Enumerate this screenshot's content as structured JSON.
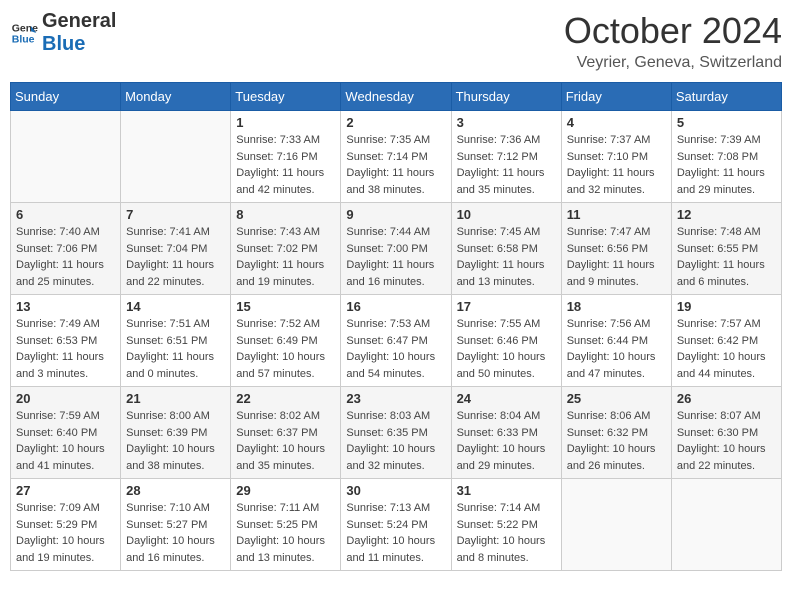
{
  "header": {
    "logo_text1": "General",
    "logo_text2": "Blue",
    "month": "October 2024",
    "location": "Veyrier, Geneva, Switzerland"
  },
  "weekdays": [
    "Sunday",
    "Monday",
    "Tuesday",
    "Wednesday",
    "Thursday",
    "Friday",
    "Saturday"
  ],
  "weeks": [
    [
      {
        "day": "",
        "sunrise": "",
        "sunset": "",
        "daylight": ""
      },
      {
        "day": "",
        "sunrise": "",
        "sunset": "",
        "daylight": ""
      },
      {
        "day": "1",
        "sunrise": "Sunrise: 7:33 AM",
        "sunset": "Sunset: 7:16 PM",
        "daylight": "Daylight: 11 hours and 42 minutes."
      },
      {
        "day": "2",
        "sunrise": "Sunrise: 7:35 AM",
        "sunset": "Sunset: 7:14 PM",
        "daylight": "Daylight: 11 hours and 38 minutes."
      },
      {
        "day": "3",
        "sunrise": "Sunrise: 7:36 AM",
        "sunset": "Sunset: 7:12 PM",
        "daylight": "Daylight: 11 hours and 35 minutes."
      },
      {
        "day": "4",
        "sunrise": "Sunrise: 7:37 AM",
        "sunset": "Sunset: 7:10 PM",
        "daylight": "Daylight: 11 hours and 32 minutes."
      },
      {
        "day": "5",
        "sunrise": "Sunrise: 7:39 AM",
        "sunset": "Sunset: 7:08 PM",
        "daylight": "Daylight: 11 hours and 29 minutes."
      }
    ],
    [
      {
        "day": "6",
        "sunrise": "Sunrise: 7:40 AM",
        "sunset": "Sunset: 7:06 PM",
        "daylight": "Daylight: 11 hours and 25 minutes."
      },
      {
        "day": "7",
        "sunrise": "Sunrise: 7:41 AM",
        "sunset": "Sunset: 7:04 PM",
        "daylight": "Daylight: 11 hours and 22 minutes."
      },
      {
        "day": "8",
        "sunrise": "Sunrise: 7:43 AM",
        "sunset": "Sunset: 7:02 PM",
        "daylight": "Daylight: 11 hours and 19 minutes."
      },
      {
        "day": "9",
        "sunrise": "Sunrise: 7:44 AM",
        "sunset": "Sunset: 7:00 PM",
        "daylight": "Daylight: 11 hours and 16 minutes."
      },
      {
        "day": "10",
        "sunrise": "Sunrise: 7:45 AM",
        "sunset": "Sunset: 6:58 PM",
        "daylight": "Daylight: 11 hours and 13 minutes."
      },
      {
        "day": "11",
        "sunrise": "Sunrise: 7:47 AM",
        "sunset": "Sunset: 6:56 PM",
        "daylight": "Daylight: 11 hours and 9 minutes."
      },
      {
        "day": "12",
        "sunrise": "Sunrise: 7:48 AM",
        "sunset": "Sunset: 6:55 PM",
        "daylight": "Daylight: 11 hours and 6 minutes."
      }
    ],
    [
      {
        "day": "13",
        "sunrise": "Sunrise: 7:49 AM",
        "sunset": "Sunset: 6:53 PM",
        "daylight": "Daylight: 11 hours and 3 minutes."
      },
      {
        "day": "14",
        "sunrise": "Sunrise: 7:51 AM",
        "sunset": "Sunset: 6:51 PM",
        "daylight": "Daylight: 11 hours and 0 minutes."
      },
      {
        "day": "15",
        "sunrise": "Sunrise: 7:52 AM",
        "sunset": "Sunset: 6:49 PM",
        "daylight": "Daylight: 10 hours and 57 minutes."
      },
      {
        "day": "16",
        "sunrise": "Sunrise: 7:53 AM",
        "sunset": "Sunset: 6:47 PM",
        "daylight": "Daylight: 10 hours and 54 minutes."
      },
      {
        "day": "17",
        "sunrise": "Sunrise: 7:55 AM",
        "sunset": "Sunset: 6:46 PM",
        "daylight": "Daylight: 10 hours and 50 minutes."
      },
      {
        "day": "18",
        "sunrise": "Sunrise: 7:56 AM",
        "sunset": "Sunset: 6:44 PM",
        "daylight": "Daylight: 10 hours and 47 minutes."
      },
      {
        "day": "19",
        "sunrise": "Sunrise: 7:57 AM",
        "sunset": "Sunset: 6:42 PM",
        "daylight": "Daylight: 10 hours and 44 minutes."
      }
    ],
    [
      {
        "day": "20",
        "sunrise": "Sunrise: 7:59 AM",
        "sunset": "Sunset: 6:40 PM",
        "daylight": "Daylight: 10 hours and 41 minutes."
      },
      {
        "day": "21",
        "sunrise": "Sunrise: 8:00 AM",
        "sunset": "Sunset: 6:39 PM",
        "daylight": "Daylight: 10 hours and 38 minutes."
      },
      {
        "day": "22",
        "sunrise": "Sunrise: 8:02 AM",
        "sunset": "Sunset: 6:37 PM",
        "daylight": "Daylight: 10 hours and 35 minutes."
      },
      {
        "day": "23",
        "sunrise": "Sunrise: 8:03 AM",
        "sunset": "Sunset: 6:35 PM",
        "daylight": "Daylight: 10 hours and 32 minutes."
      },
      {
        "day": "24",
        "sunrise": "Sunrise: 8:04 AM",
        "sunset": "Sunset: 6:33 PM",
        "daylight": "Daylight: 10 hours and 29 minutes."
      },
      {
        "day": "25",
        "sunrise": "Sunrise: 8:06 AM",
        "sunset": "Sunset: 6:32 PM",
        "daylight": "Daylight: 10 hours and 26 minutes."
      },
      {
        "day": "26",
        "sunrise": "Sunrise: 8:07 AM",
        "sunset": "Sunset: 6:30 PM",
        "daylight": "Daylight: 10 hours and 22 minutes."
      }
    ],
    [
      {
        "day": "27",
        "sunrise": "Sunrise: 7:09 AM",
        "sunset": "Sunset: 5:29 PM",
        "daylight": "Daylight: 10 hours and 19 minutes."
      },
      {
        "day": "28",
        "sunrise": "Sunrise: 7:10 AM",
        "sunset": "Sunset: 5:27 PM",
        "daylight": "Daylight: 10 hours and 16 minutes."
      },
      {
        "day": "29",
        "sunrise": "Sunrise: 7:11 AM",
        "sunset": "Sunset: 5:25 PM",
        "daylight": "Daylight: 10 hours and 13 minutes."
      },
      {
        "day": "30",
        "sunrise": "Sunrise: 7:13 AM",
        "sunset": "Sunset: 5:24 PM",
        "daylight": "Daylight: 10 hours and 11 minutes."
      },
      {
        "day": "31",
        "sunrise": "Sunrise: 7:14 AM",
        "sunset": "Sunset: 5:22 PM",
        "daylight": "Daylight: 10 hours and 8 minutes."
      },
      {
        "day": "",
        "sunrise": "",
        "sunset": "",
        "daylight": ""
      },
      {
        "day": "",
        "sunrise": "",
        "sunset": "",
        "daylight": ""
      }
    ]
  ]
}
